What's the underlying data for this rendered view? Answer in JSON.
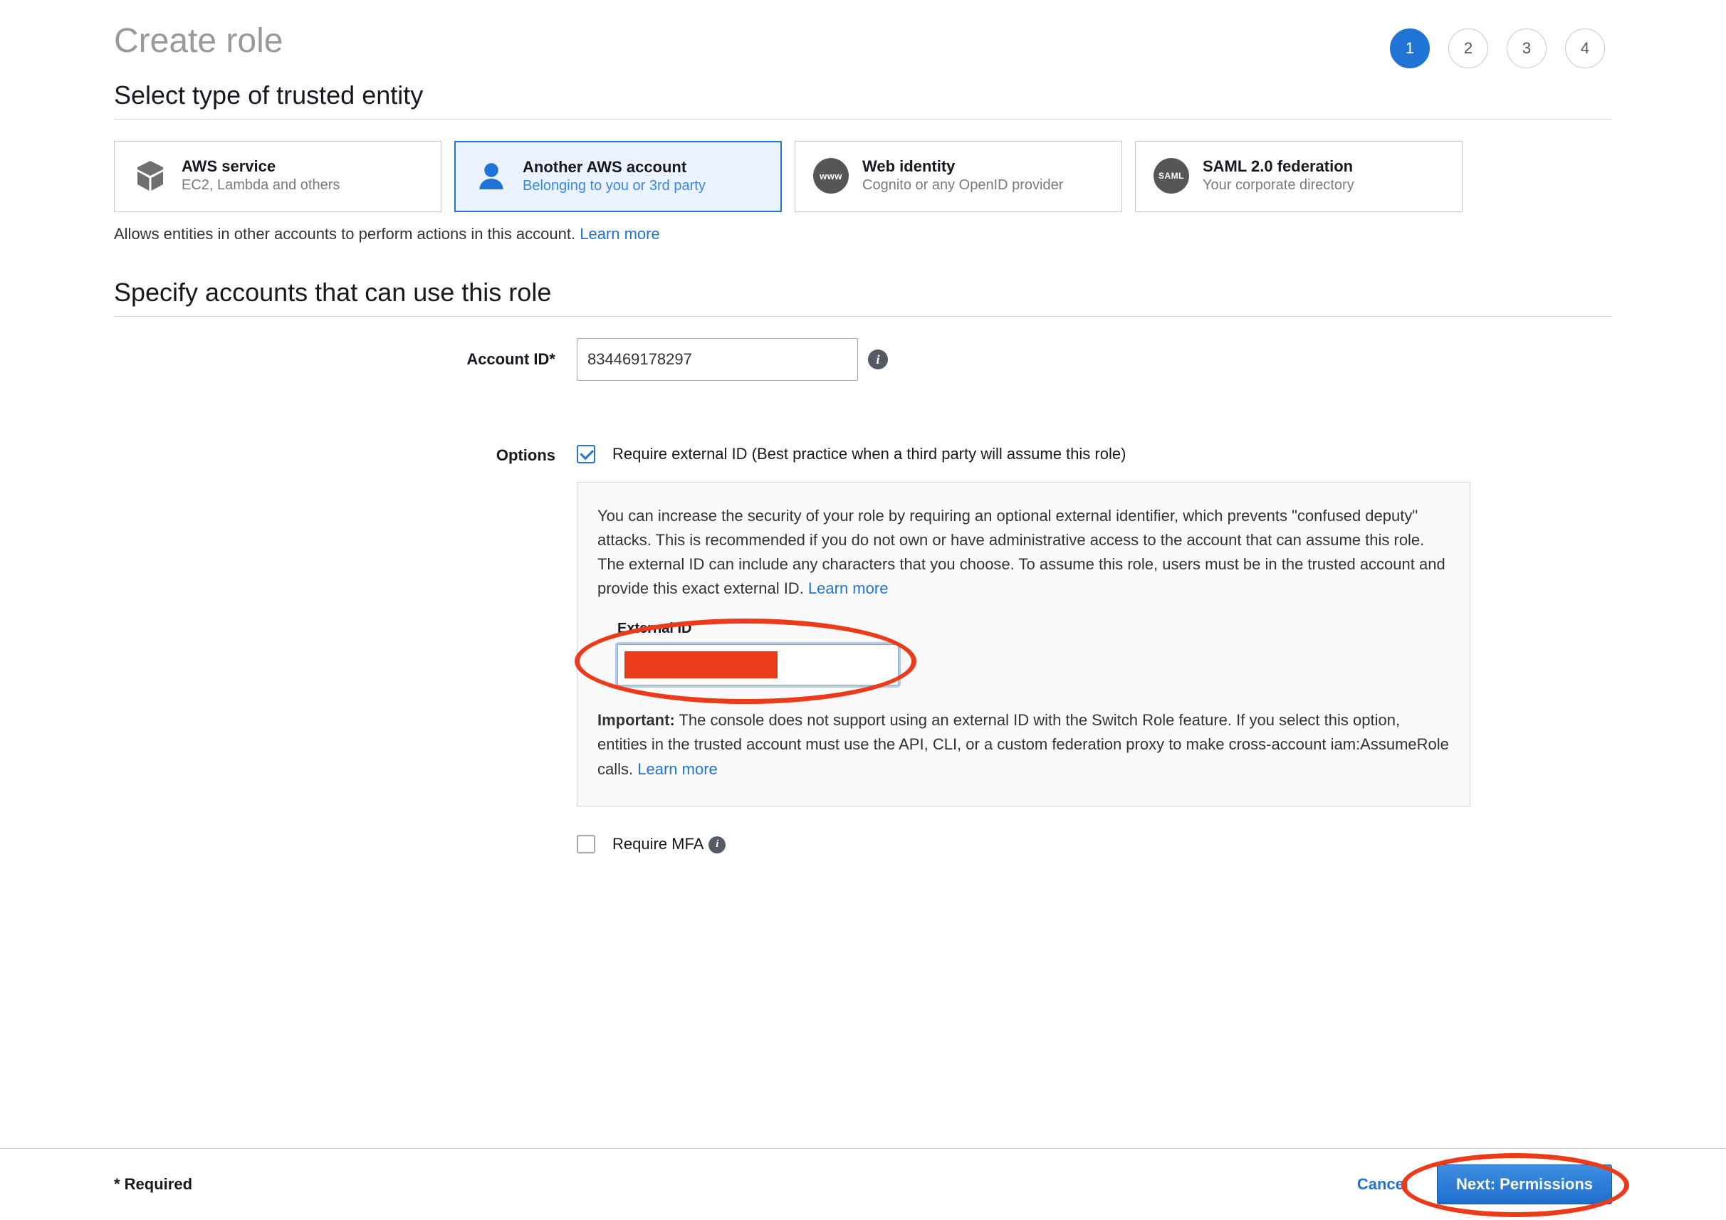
{
  "page_title": "Create role",
  "steps": {
    "current": 1,
    "labels": [
      "1",
      "2",
      "3",
      "4"
    ]
  },
  "section_trusted_title": "Select type of trusted entity",
  "entity_cards": [
    {
      "title": "AWS service",
      "subtitle": "EC2, Lambda and others"
    },
    {
      "title": "Another AWS account",
      "subtitle": "Belonging to you or 3rd party"
    },
    {
      "title": "Web identity",
      "subtitle": "Cognito or any OpenID provider"
    },
    {
      "title": "SAML 2.0 federation",
      "subtitle": "Your corporate directory"
    }
  ],
  "help_line": {
    "text": "Allows entities in other accounts to perform actions in this account. ",
    "link": "Learn more"
  },
  "section_specify_title": "Specify accounts that can use this role",
  "account_id": {
    "label": "Account ID*",
    "value": "834469178297"
  },
  "options": {
    "label": "Options",
    "require_external_checked": true,
    "require_external_label": "Require external ID (Best practice when a third party will assume this role)",
    "panel_text": "You can increase the security of your role by requiring an optional external identifier, which prevents \"confused deputy\" attacks. This is recommended if you do not own or have administrative access to the account that can assume this role. The external ID can include any characters that you choose. To assume this role, users must be in the trusted account and provide this exact external ID. ",
    "panel_learn_more": "Learn more",
    "external_id_label": "External ID",
    "external_id_value": "",
    "warning_prefix": "Important:",
    "warning_text": " The console does not support using an external ID with the Switch Role feature. If you select this option, entities in the trusted account must use the API, CLI, or a custom federation proxy to make cross-account iam:AssumeRole calls. ",
    "warning_learn_more": "Learn more",
    "require_mfa_checked": false,
    "require_mfa_label": "Require MFA"
  },
  "footer": {
    "required_note": "* Required",
    "cancel": "Cancel",
    "next": "Next: Permissions"
  },
  "icons": {
    "www": "www",
    "saml": "SAML"
  }
}
